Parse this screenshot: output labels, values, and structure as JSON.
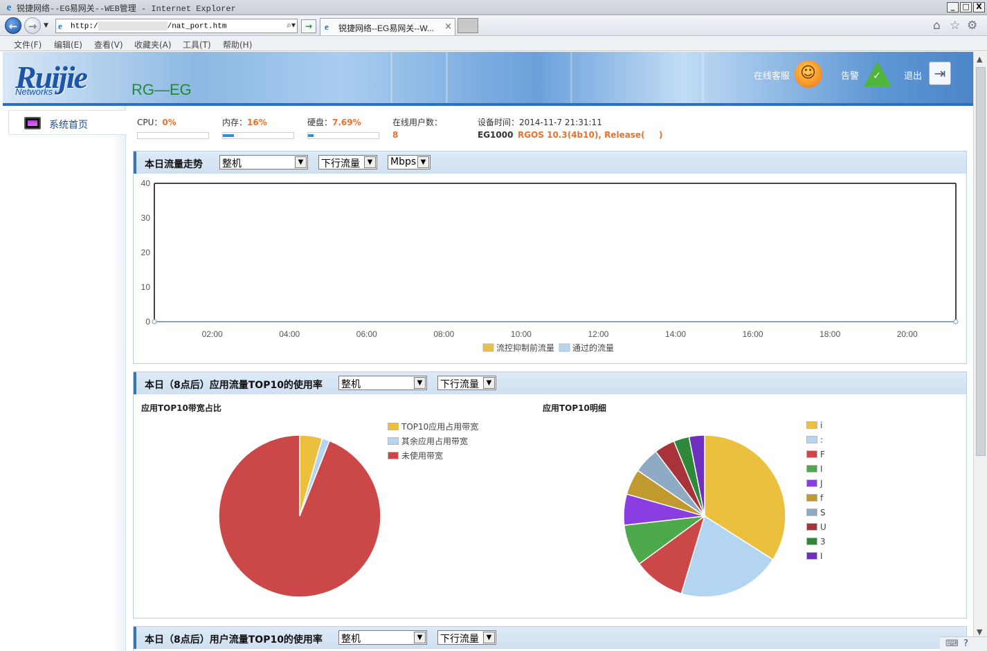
{
  "browser": {
    "window_title": "锐捷网络--EG易网关--WEB管理 - Internet Explorer",
    "address_prefix": "http:/",
    "address_suffix": "/nat_port.htm",
    "tab_label": "锐捷网络--EG易网关--W...",
    "window_buttons": [
      "_",
      "□",
      "X"
    ],
    "menu": [
      "文件(F)",
      "编辑(E)",
      "查看(V)",
      "收藏夹(A)",
      "工具(T)",
      "帮助(H)"
    ]
  },
  "header": {
    "logo": "Ruijie",
    "logo_sub": "Networks",
    "product": "RG—EG",
    "support_label": "在线客服",
    "alarm_label": "告警",
    "logout_label": "退出"
  },
  "sidebar": {
    "home_label": "系统首页"
  },
  "status": {
    "cpu_label": "CPU：",
    "cpu_value": "0%",
    "cpu_percent": 0,
    "mem_label": "内存：",
    "mem_value": "16%",
    "mem_percent": 16,
    "disk_label": "硬盘：",
    "disk_value": "7.69%",
    "disk_percent": 7.69,
    "online_label": "在线用户数：",
    "online_value": "8",
    "time_label": "设备时间：",
    "time_value": "2014-11-7 21:31:11",
    "model": "EG1000",
    "version": "RGOS 10.3(4b10), Release(",
    "version_end": ")"
  },
  "trend_panel": {
    "title": "本日流量走势",
    "scope_select": "整机",
    "direction_select": "下行流量",
    "unit_select": "Mbps"
  },
  "app_panel": {
    "title": "本日（8点后）应用流量TOP10的使用率",
    "scope_select": "整机",
    "direction_select": "下行流量",
    "left_title": "应用TOP10带宽占比",
    "right_title": "应用TOP10明细"
  },
  "user_panel": {
    "title": "本日（8点后）用户流量TOP10的使用率",
    "scope_select": "整机",
    "direction_select": "下行流量"
  },
  "chart_data": [
    {
      "type": "line",
      "title": "",
      "x": [
        "02:00",
        "04:00",
        "06:00",
        "08:00",
        "10:00",
        "12:00",
        "14:00",
        "16:00",
        "18:00",
        "20:00"
      ],
      "ylim": [
        0,
        40
      ],
      "yticks": [
        0,
        10,
        20,
        30,
        40
      ],
      "grid": false,
      "legend_position": "bottom",
      "series": [
        {
          "name": "流控抑制前流量",
          "color": "#e8c04a",
          "values": [
            0,
            0,
            0,
            0,
            0,
            0,
            0,
            0,
            0,
            0
          ]
        },
        {
          "name": "通过的流量",
          "color": "#b6d7f0",
          "values": [
            0,
            0,
            0,
            0,
            0,
            0,
            0,
            0,
            0,
            0
          ]
        }
      ]
    },
    {
      "type": "pie",
      "title": "应用TOP10带宽占比",
      "legend_position": "right",
      "slices": [
        {
          "name": "TOP10应用占用带宽",
          "value": 4.5,
          "color": "#ebc03f"
        },
        {
          "name": "其余应用占用带宽",
          "value": 1.5,
          "color": "#b3d5f2"
        },
        {
          "name": "未使用带宽",
          "value": 94.0,
          "color": "#cc4848"
        }
      ]
    },
    {
      "type": "pie",
      "title": "应用TOP10明细",
      "legend_position": "right",
      "slices": [
        {
          "name": "i",
          "value": 33,
          "color": "#ebc03f"
        },
        {
          "name": ":",
          "value": 20,
          "color": "#b3d5f2"
        },
        {
          "name": "F",
          "value": 10,
          "color": "#cc4848"
        },
        {
          "name": "I",
          "value": 8,
          "color": "#4caa4c"
        },
        {
          "name": "J",
          "value": 6,
          "color": "#8a3de0"
        },
        {
          "name": "f",
          "value": 5,
          "color": "#c09a2e"
        },
        {
          "name": "S",
          "value": 5,
          "color": "#8faac4"
        },
        {
          "name": "U",
          "value": 4,
          "color": "#a83338"
        },
        {
          "name": "3",
          "value": 3,
          "color": "#2e8a3a"
        },
        {
          "name": "I",
          "value": 3,
          "color": "#6f2fc0"
        }
      ]
    }
  ]
}
